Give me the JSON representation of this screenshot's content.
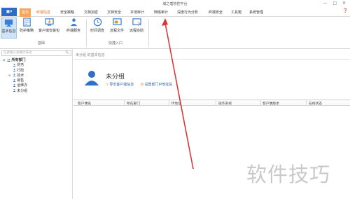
{
  "window": {
    "title": "域之盾管控平台",
    "controls": "— □ ✕"
  },
  "app_button": {
    "icon": "menu-icon",
    "glyph": "▣▾"
  },
  "tabs": [
    {
      "label": "首页",
      "state": "active"
    },
    {
      "label": "终端信息",
      "state": "selected"
    },
    {
      "label": "安全策略",
      "state": ""
    },
    {
      "label": "文档加密",
      "state": ""
    },
    {
      "label": "文档安全",
      "state": ""
    },
    {
      "label": "本地审计",
      "state": ""
    },
    {
      "label": "网络审计",
      "state": ""
    },
    {
      "label": "深度行为分析",
      "state": ""
    },
    {
      "label": "终端安全",
      "state": ""
    },
    {
      "label": "工具箱",
      "state": ""
    },
    {
      "label": "系统管理",
      "state": ""
    }
  ],
  "help_icon": "❓",
  "ribbon": {
    "groups": [
      {
        "label": "基础"
      },
      {
        "label": "快捷入口"
      }
    ],
    "buttons": [
      {
        "label": "基本信息",
        "icon": "terminal-info-icon",
        "active": true
      },
      {
        "label": "防护策略",
        "icon": "protect-policy-icon"
      },
      {
        "label": "客户端安装包",
        "icon": "client-package-icon"
      },
      {
        "label": "终端服务",
        "icon": "terminal-service-icon"
      },
      {
        "label": "时间调查",
        "icon": "clock-icon"
      },
      {
        "label": "远程文件",
        "icon": "remote-file-icon"
      },
      {
        "label": "远程协助",
        "icon": "remote-assist-icon"
      }
    ]
  },
  "sidebar": {
    "search_placeholder": "在此输入关键字筛选",
    "tree": {
      "root": "所有部门",
      "children": [
        "财务",
        "行政",
        "技术",
        "销售",
        "运维办",
        "未分组"
      ]
    }
  },
  "main": {
    "breadcrumb": "未分组 的基本信息",
    "group_title": "未分组",
    "links": [
      {
        "label": "导出客户端信息",
        "icon": "export-icon"
      },
      {
        "label": "设置部门IP地址段",
        "icon": "ip-settings-icon"
      }
    ],
    "table": {
      "columns": [
        "客户端名",
        "所在部门",
        "IP地址",
        "操作系统",
        "客户端版本",
        "在线状态"
      ]
    }
  },
  "watermark": "软件技巧",
  "colors": {
    "accent": "#2b6cc4",
    "active_tab": "#f6a55b",
    "annotation_arrow": "#d9373a",
    "link": "#2b5ea8"
  }
}
